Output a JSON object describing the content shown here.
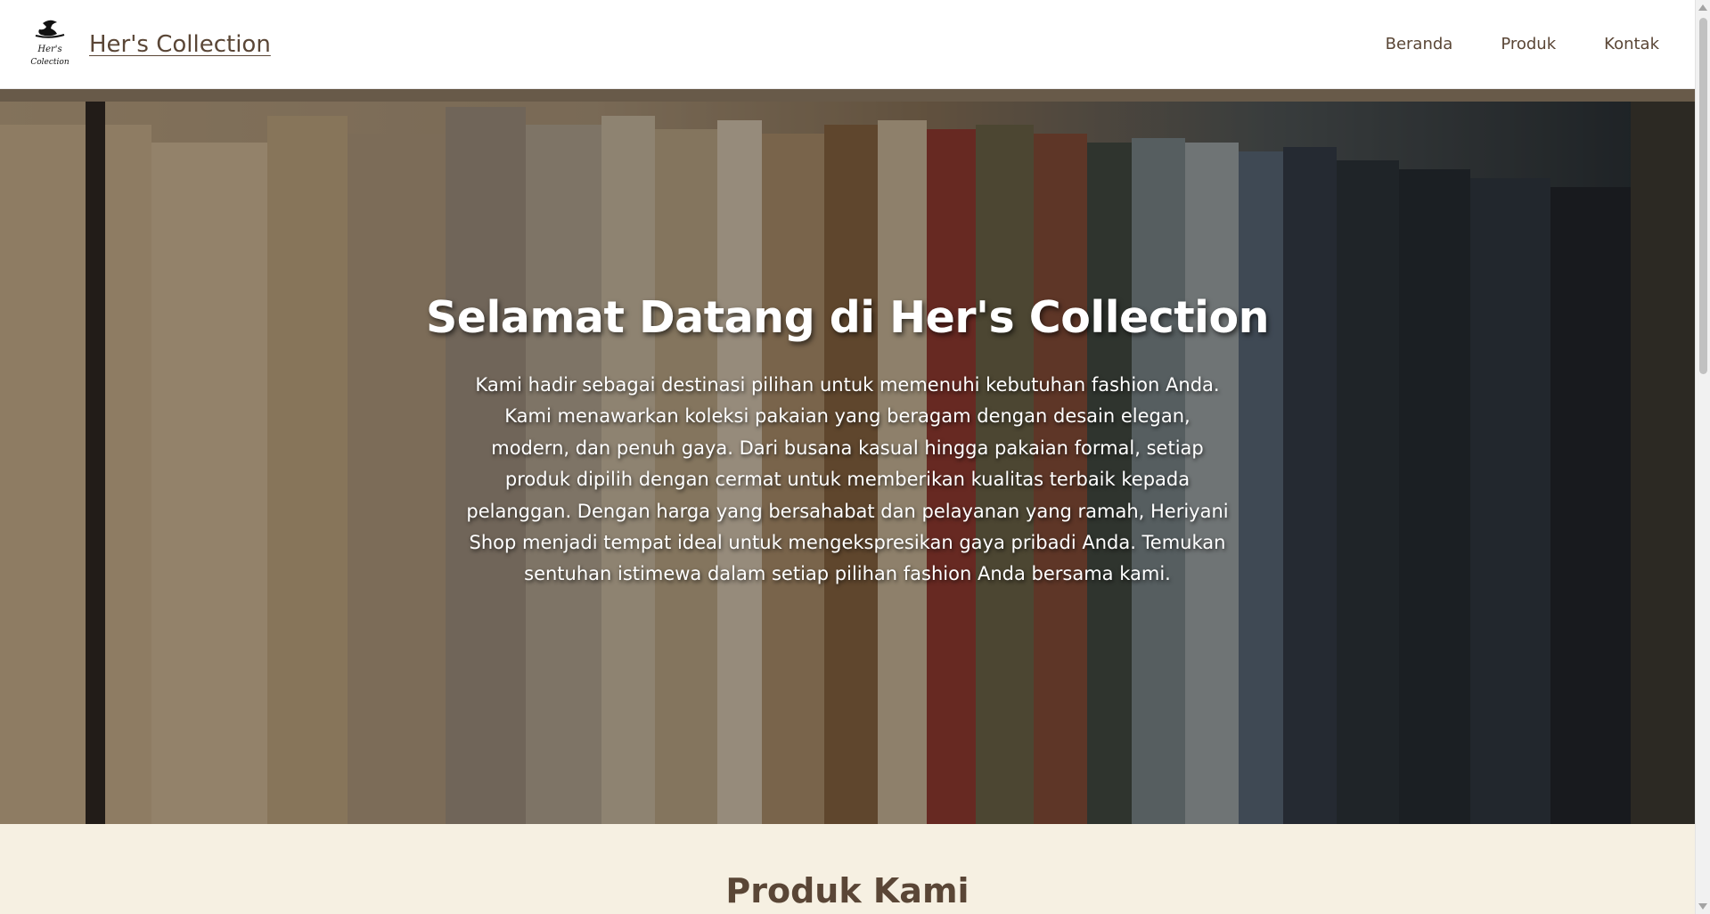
{
  "header": {
    "brand": "Her's Collection",
    "logo_icon": "hat-woman-logo-icon",
    "nav": [
      {
        "label": "Beranda"
      },
      {
        "label": "Produk"
      },
      {
        "label": "Kontak"
      }
    ]
  },
  "hero": {
    "title": "Selamat Datang di Her's Collection",
    "description": "Kami hadir sebagai destinasi pilihan untuk memenuhi kebutuhan fashion Anda. Kami menawarkan koleksi pakaian yang beragam dengan desain elegan, modern, dan penuh gaya. Dari busana kasual hingga pakaian formal, setiap produk dipilih dengan cermat untuk memberikan kualitas terbaik kepada pelanggan. Dengan harga yang bersahabat dan pelayanan yang ramah, Heriyani Shop menjadi tempat ideal untuk mengekspresikan gaya pribadi Anda. Temukan sentuhan istimewa dalam setiap pilihan fashion Anda bersama kami.",
    "background_icon": "clothes-rack-photo"
  },
  "products": {
    "title": "Produk Kami"
  },
  "colors": {
    "brand_text": "#5a4636",
    "section_bg": "#f6f0e2",
    "header_bg": "#ffffff"
  }
}
